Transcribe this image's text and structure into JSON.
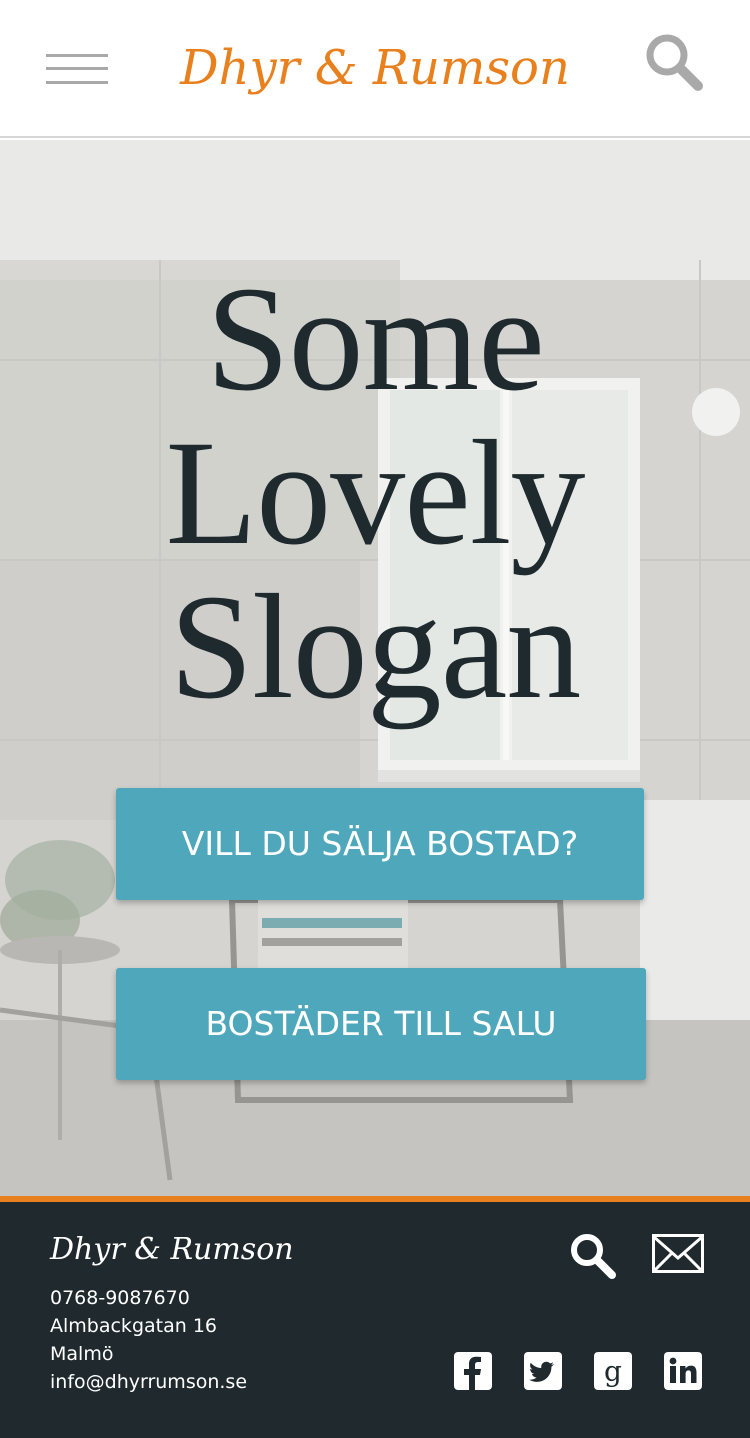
{
  "header": {
    "brand": "Dhyr & Rumson",
    "menu_icon": "hamburger-menu-icon",
    "search_icon": "search-icon",
    "accent_color": "#e8801e"
  },
  "hero": {
    "slogan_line1": "Some",
    "slogan_line2": "Lovely",
    "slogan_line3": "Slogan",
    "cta_sell": "VILL DU SÄLJA BOSTAD?",
    "cta_listings": "BOSTÄDER TILL SALU",
    "button_color": "#4ea7ba"
  },
  "footer": {
    "brand": "Dhyr & Rumson",
    "phone": "0768-9087670",
    "street": "Almbackgatan 16",
    "city": "Malmö",
    "email": "info@dhyrrumson.se",
    "icons": [
      "search-icon",
      "mail-icon",
      "facebook-icon",
      "twitter-icon",
      "google-plus-icon",
      "linkedin-icon"
    ],
    "background_color": "#202a2e"
  }
}
